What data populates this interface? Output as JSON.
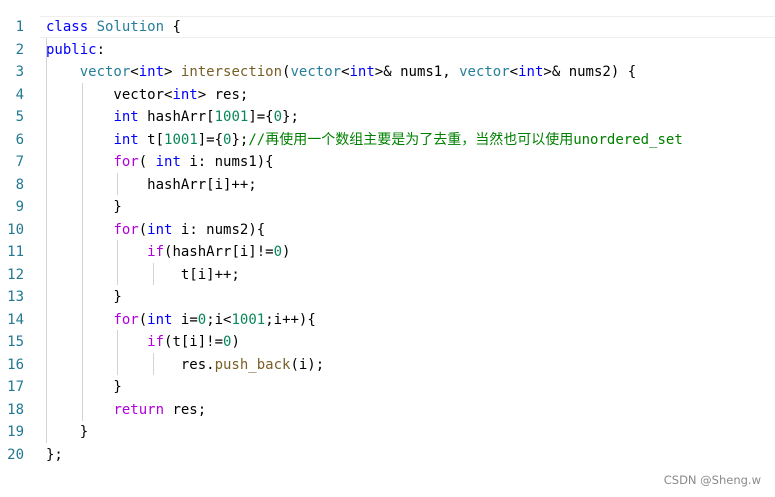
{
  "lines": [
    {
      "num": "1",
      "tokens": [
        {
          "t": "class",
          "c": "kw"
        },
        {
          "t": " ",
          "c": "pl"
        },
        {
          "t": "Solution",
          "c": "ty"
        },
        {
          "t": " {",
          "c": "pl"
        }
      ]
    },
    {
      "num": "2",
      "tokens": [
        {
          "t": "public",
          "c": "kw"
        },
        {
          "t": ":",
          "c": "pl"
        }
      ]
    },
    {
      "num": "3",
      "tokens": [
        {
          "t": "    ",
          "c": "pl"
        },
        {
          "t": "vector",
          "c": "ty"
        },
        {
          "t": "<",
          "c": "pl"
        },
        {
          "t": "int",
          "c": "kw"
        },
        {
          "t": "> ",
          "c": "pl"
        },
        {
          "t": "intersection",
          "c": "fn"
        },
        {
          "t": "(",
          "c": "pl"
        },
        {
          "t": "vector",
          "c": "ty"
        },
        {
          "t": "<",
          "c": "pl"
        },
        {
          "t": "int",
          "c": "kw"
        },
        {
          "t": ">& nums1, ",
          "c": "pl"
        },
        {
          "t": "vector",
          "c": "ty"
        },
        {
          "t": "<",
          "c": "pl"
        },
        {
          "t": "int",
          "c": "kw"
        },
        {
          "t": ">& nums2) {",
          "c": "pl"
        }
      ]
    },
    {
      "num": "4",
      "tokens": [
        {
          "t": "        vector<",
          "c": "pl"
        },
        {
          "t": "int",
          "c": "kw"
        },
        {
          "t": "> res;",
          "c": "pl"
        }
      ]
    },
    {
      "num": "5",
      "tokens": [
        {
          "t": "        ",
          "c": "pl"
        },
        {
          "t": "int",
          "c": "kw"
        },
        {
          "t": " hashArr[",
          "c": "pl"
        },
        {
          "t": "1001",
          "c": "num"
        },
        {
          "t": "]={",
          "c": "pl"
        },
        {
          "t": "0",
          "c": "num"
        },
        {
          "t": "};",
          "c": "pl"
        }
      ]
    },
    {
      "num": "6",
      "tokens": [
        {
          "t": "        ",
          "c": "pl"
        },
        {
          "t": "int",
          "c": "kw"
        },
        {
          "t": " t[",
          "c": "pl"
        },
        {
          "t": "1001",
          "c": "num"
        },
        {
          "t": "]={",
          "c": "pl"
        },
        {
          "t": "0",
          "c": "num"
        },
        {
          "t": "};",
          "c": "pl"
        },
        {
          "t": "//再使用一个数组主要是为了去重，当然也可以使用unordered_set",
          "c": "cm"
        }
      ]
    },
    {
      "num": "7",
      "tokens": [
        {
          "t": "        ",
          "c": "pl"
        },
        {
          "t": "for",
          "c": "ctl"
        },
        {
          "t": "( ",
          "c": "pl"
        },
        {
          "t": "int",
          "c": "kw"
        },
        {
          "t": " i: nums1){",
          "c": "pl"
        }
      ]
    },
    {
      "num": "8",
      "tokens": [
        {
          "t": "            hashArr[i]++;",
          "c": "pl"
        }
      ]
    },
    {
      "num": "9",
      "tokens": [
        {
          "t": "        }",
          "c": "pl"
        }
      ]
    },
    {
      "num": "10",
      "tokens": [
        {
          "t": "        ",
          "c": "pl"
        },
        {
          "t": "for",
          "c": "ctl"
        },
        {
          "t": "(",
          "c": "pl"
        },
        {
          "t": "int",
          "c": "kw"
        },
        {
          "t": " i: nums2){",
          "c": "pl"
        }
      ]
    },
    {
      "num": "11",
      "tokens": [
        {
          "t": "            ",
          "c": "pl"
        },
        {
          "t": "if",
          "c": "ctl"
        },
        {
          "t": "(hashArr[i]!=",
          "c": "pl"
        },
        {
          "t": "0",
          "c": "num"
        },
        {
          "t": ")",
          "c": "pl"
        }
      ]
    },
    {
      "num": "12",
      "tokens": [
        {
          "t": "                t[i]++;",
          "c": "pl"
        }
      ]
    },
    {
      "num": "13",
      "tokens": [
        {
          "t": "        }",
          "c": "pl"
        }
      ]
    },
    {
      "num": "14",
      "tokens": [
        {
          "t": "        ",
          "c": "pl"
        },
        {
          "t": "for",
          "c": "ctl"
        },
        {
          "t": "(",
          "c": "pl"
        },
        {
          "t": "int",
          "c": "kw"
        },
        {
          "t": " i=",
          "c": "pl"
        },
        {
          "t": "0",
          "c": "num"
        },
        {
          "t": ";i<",
          "c": "pl"
        },
        {
          "t": "1001",
          "c": "num"
        },
        {
          "t": ";i++){",
          "c": "pl"
        }
      ]
    },
    {
      "num": "15",
      "tokens": [
        {
          "t": "            ",
          "c": "pl"
        },
        {
          "t": "if",
          "c": "ctl"
        },
        {
          "t": "(t[i]!=",
          "c": "pl"
        },
        {
          "t": "0",
          "c": "num"
        },
        {
          "t": ")",
          "c": "pl"
        }
      ]
    },
    {
      "num": "16",
      "tokens": [
        {
          "t": "                res.",
          "c": "pl"
        },
        {
          "t": "push_back",
          "c": "fn"
        },
        {
          "t": "(i);",
          "c": "pl"
        }
      ]
    },
    {
      "num": "17",
      "tokens": [
        {
          "t": "        }",
          "c": "pl"
        }
      ]
    },
    {
      "num": "18",
      "tokens": [
        {
          "t": "        ",
          "c": "pl"
        },
        {
          "t": "return",
          "c": "ctl"
        },
        {
          "t": " res;",
          "c": "pl"
        }
      ]
    },
    {
      "num": "19",
      "tokens": [
        {
          "t": "    }",
          "c": "pl"
        }
      ]
    },
    {
      "num": "20",
      "tokens": [
        {
          "t": "};",
          "c": "pl"
        }
      ]
    }
  ],
  "watermark": "CSDN @Sheng.w",
  "colors": {
    "keyword": "#0000ff",
    "control": "#af00db",
    "type": "#267f99",
    "function": "#795e26",
    "number": "#098658",
    "comment": "#008000",
    "line_number": "#237893"
  }
}
